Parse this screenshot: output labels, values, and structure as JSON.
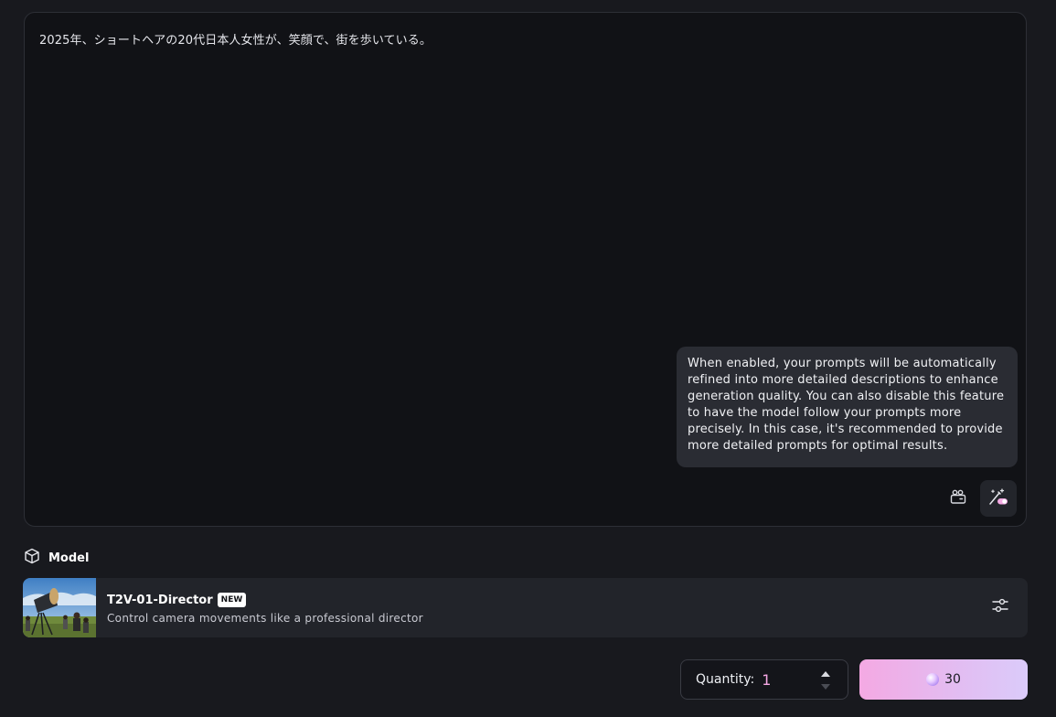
{
  "prompt": {
    "text": "2025年、ショートヘアの20代日本人女性が、笑顔で、街を歩いている。"
  },
  "tooltip": {
    "text": "When enabled, your prompts will be automatically refined into more detailed descriptions to enhance generation quality. You can also disable this feature to have the model follow your prompts more precisely. In this case, it's recommended to provide more detailed prompts for optimal results."
  },
  "toolbar": {
    "camera_icon": "camera-icon",
    "enhance_icon": "prompt-enhance-icon"
  },
  "model_section": {
    "title": "Model",
    "icon": "cube-icon"
  },
  "model": {
    "name": "T2V-01-Director",
    "badge": "NEW",
    "description": "Control camera movements like a professional director",
    "settings_icon": "sliders-icon"
  },
  "quantity": {
    "label": "Quantity:",
    "value": "1"
  },
  "generate": {
    "cost": "30",
    "icon": "credit-orb-icon"
  },
  "colors": {
    "background": "#18191e",
    "panel": "#111216",
    "accent_pink": "#f4a9e3",
    "accent_lavender": "#dbcbfa"
  }
}
